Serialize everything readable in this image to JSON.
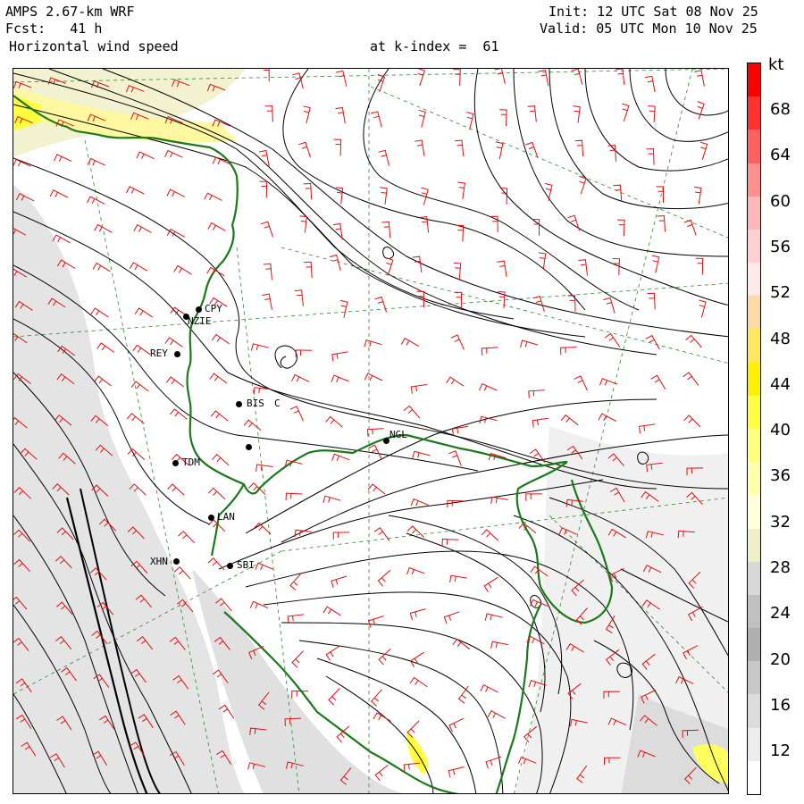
{
  "header": {
    "model": "AMPS 2.67-km WRF",
    "forecast": "Fcst:   41 h",
    "field": "Horizontal wind speed",
    "level": "at k-index =  61",
    "init": "Init: 12 UTC Sat 08 Nov 25",
    "valid": "Valid: 05 UTC Mon 10 Nov 25"
  },
  "stations": [
    {
      "label": "CPY"
    },
    {
      "label": "NZIE"
    },
    {
      "label": "REY"
    },
    {
      "label": "BIS"
    },
    {
      "label": "C"
    },
    {
      "label": "NGL"
    },
    {
      "label": "TDM"
    },
    {
      "label": "LAN"
    },
    {
      "label": "XHN"
    },
    {
      "label": "SBI"
    }
  ],
  "colorbar": {
    "unit": "kt",
    "labels": [
      "68",
      "64",
      "60",
      "56",
      "52",
      "48",
      "44",
      "40",
      "36",
      "32",
      "28",
      "24",
      "20",
      "16",
      "12"
    ],
    "colors": [
      "#ff0000",
      "#ff3030",
      "#ff6060",
      "#ff9090",
      "#ffb8b8",
      "#ffd0d0",
      "#ffe8e8",
      "#ffd8a8",
      "#ffe860",
      "#fff000",
      "#ffff40",
      "#ffff80",
      "#ffffb0",
      "#ffffd8",
      "#f0f0c8",
      "#d8d8d8",
      "#c0c0c0",
      "#b0b0b0",
      "#c8c8c8",
      "#dcdcdc",
      "#ececec",
      "#ffffff"
    ]
  },
  "map_colors": {
    "coast": "#1a7a1a",
    "streamline": "#000000",
    "barb": "#e01010",
    "grid": "#2a8a2a",
    "shade": "#d8d8d8",
    "highlight": "#ffff60"
  }
}
